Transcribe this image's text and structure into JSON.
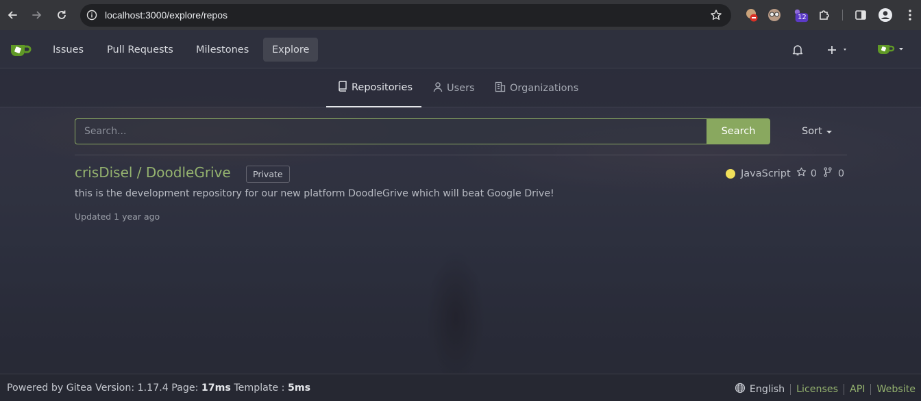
{
  "browser": {
    "url": "localhost:3000/explore/repos",
    "ext_badge": "12"
  },
  "header": {
    "nav": [
      {
        "label": "Issues"
      },
      {
        "label": "Pull Requests"
      },
      {
        "label": "Milestones"
      },
      {
        "label": "Explore",
        "active": true
      }
    ]
  },
  "tabs": [
    {
      "label": "Repositories",
      "active": true
    },
    {
      "label": "Users"
    },
    {
      "label": "Organizations"
    }
  ],
  "search": {
    "placeholder": "Search...",
    "button_label": "Search",
    "sort_label": "Sort"
  },
  "repo": {
    "full_name": "crisDisel / DoodleGrive",
    "visibility": "Private",
    "description": "this is the development repository for our new platform DoodleGrive which will beat Google Drive!",
    "updated": "Updated 1 year ago",
    "language": "JavaScript",
    "language_color": "#f1e05a",
    "stars": "0",
    "forks": "0"
  },
  "footer": {
    "powered": "Powered by Gitea Version: 1.17.4 Page:",
    "page_time": "17ms",
    "template_label": "Template :",
    "template_time": "5ms",
    "language": "English",
    "links": [
      "Licenses",
      "API",
      "Website"
    ]
  },
  "colors": {
    "accent": "#89a85f",
    "link": "#95b36f"
  }
}
